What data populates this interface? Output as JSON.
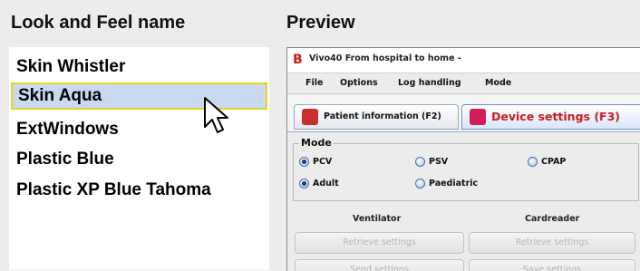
{
  "headers": {
    "left": "Look and Feel name",
    "right": "Preview"
  },
  "laf_list": {
    "items": [
      {
        "label": "Skin Whistler"
      },
      {
        "label": "Skin Aqua"
      },
      {
        "label": "ExtWindows"
      },
      {
        "label": "Plastic Blue"
      },
      {
        "label": "Plastic XP Blue Tahoma"
      }
    ],
    "selected_index": 1,
    "selection_color": "#c9d9ef",
    "focus_border_color": "#e9d420"
  },
  "preview": {
    "window_title": "Vivo40 From hospital to home -",
    "app_logo_letter": "B",
    "menu": [
      {
        "label": "File",
        "mnemonic_index": 0
      },
      {
        "label": "Options",
        "mnemonic_index": 0
      },
      {
        "label": "Log handling",
        "mnemonic_index": 0
      },
      {
        "label": "Mode",
        "mnemonic_index": 0
      }
    ],
    "tabs": [
      {
        "label": "Patient information (F2)",
        "icon": "patient-icon",
        "selected": false
      },
      {
        "label": "Device settings (F3)",
        "icon": "device-icon",
        "selected": true
      }
    ],
    "mode_group": {
      "legend": "Mode",
      "options": [
        {
          "label": "PCV",
          "checked": true
        },
        {
          "label": "PSV",
          "checked": false
        },
        {
          "label": "CPAP",
          "checked": false
        },
        {
          "label": "Adult",
          "checked": true
        },
        {
          "label": "Paediatric",
          "checked": false
        }
      ]
    },
    "sections": {
      "ventilator": "Ventilator",
      "cardreader": "Cardreader"
    },
    "buttons": {
      "retrieve_left": "Retrieve settings",
      "retrieve_right": "Retrieve settings",
      "send": "Send settings",
      "save": "Save settings"
    },
    "accent_color": "#cc1b1b"
  }
}
